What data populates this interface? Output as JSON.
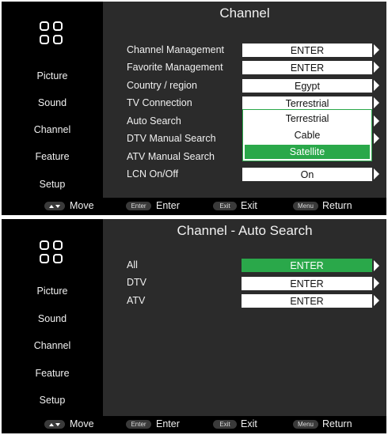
{
  "screen1": {
    "title": "Channel",
    "sidebar": [
      "Picture",
      "Sound",
      "Channel",
      "Feature",
      "Setup"
    ],
    "rows": [
      {
        "label": "Channel Management",
        "value": "ENTER"
      },
      {
        "label": "Favorite Management",
        "value": "ENTER"
      },
      {
        "label": "Country / region",
        "value": "Egypt"
      },
      {
        "label": "TV Connection",
        "value": "Terrestrial"
      },
      {
        "label": "Auto Search"
      },
      {
        "label": "DTV Manual Search"
      },
      {
        "label": "ATV Manual Search"
      },
      {
        "label": "LCN On/Off",
        "value": "On"
      }
    ],
    "dropdown": {
      "options": [
        "Terrestrial",
        "Cable",
        "Satellite"
      ],
      "selected": "Satellite"
    }
  },
  "screen2": {
    "title": "Channel - Auto Search",
    "sidebar": [
      "Picture",
      "Sound",
      "Channel",
      "Feature",
      "Setup"
    ],
    "rows": [
      {
        "label": "All",
        "value": "ENTER",
        "highlighted": true
      },
      {
        "label": "DTV",
        "value": "ENTER"
      },
      {
        "label": "ATV",
        "value": "ENTER"
      }
    ]
  },
  "footer": {
    "move": "Move",
    "enter_key": "Enter",
    "enter": "Enter",
    "exit_key": "Exit",
    "exit": "Exit",
    "menu_key": "Menu",
    "return": "Return"
  },
  "colors": {
    "panel": "#2b2b2b",
    "highlight": "#2aa84a"
  }
}
